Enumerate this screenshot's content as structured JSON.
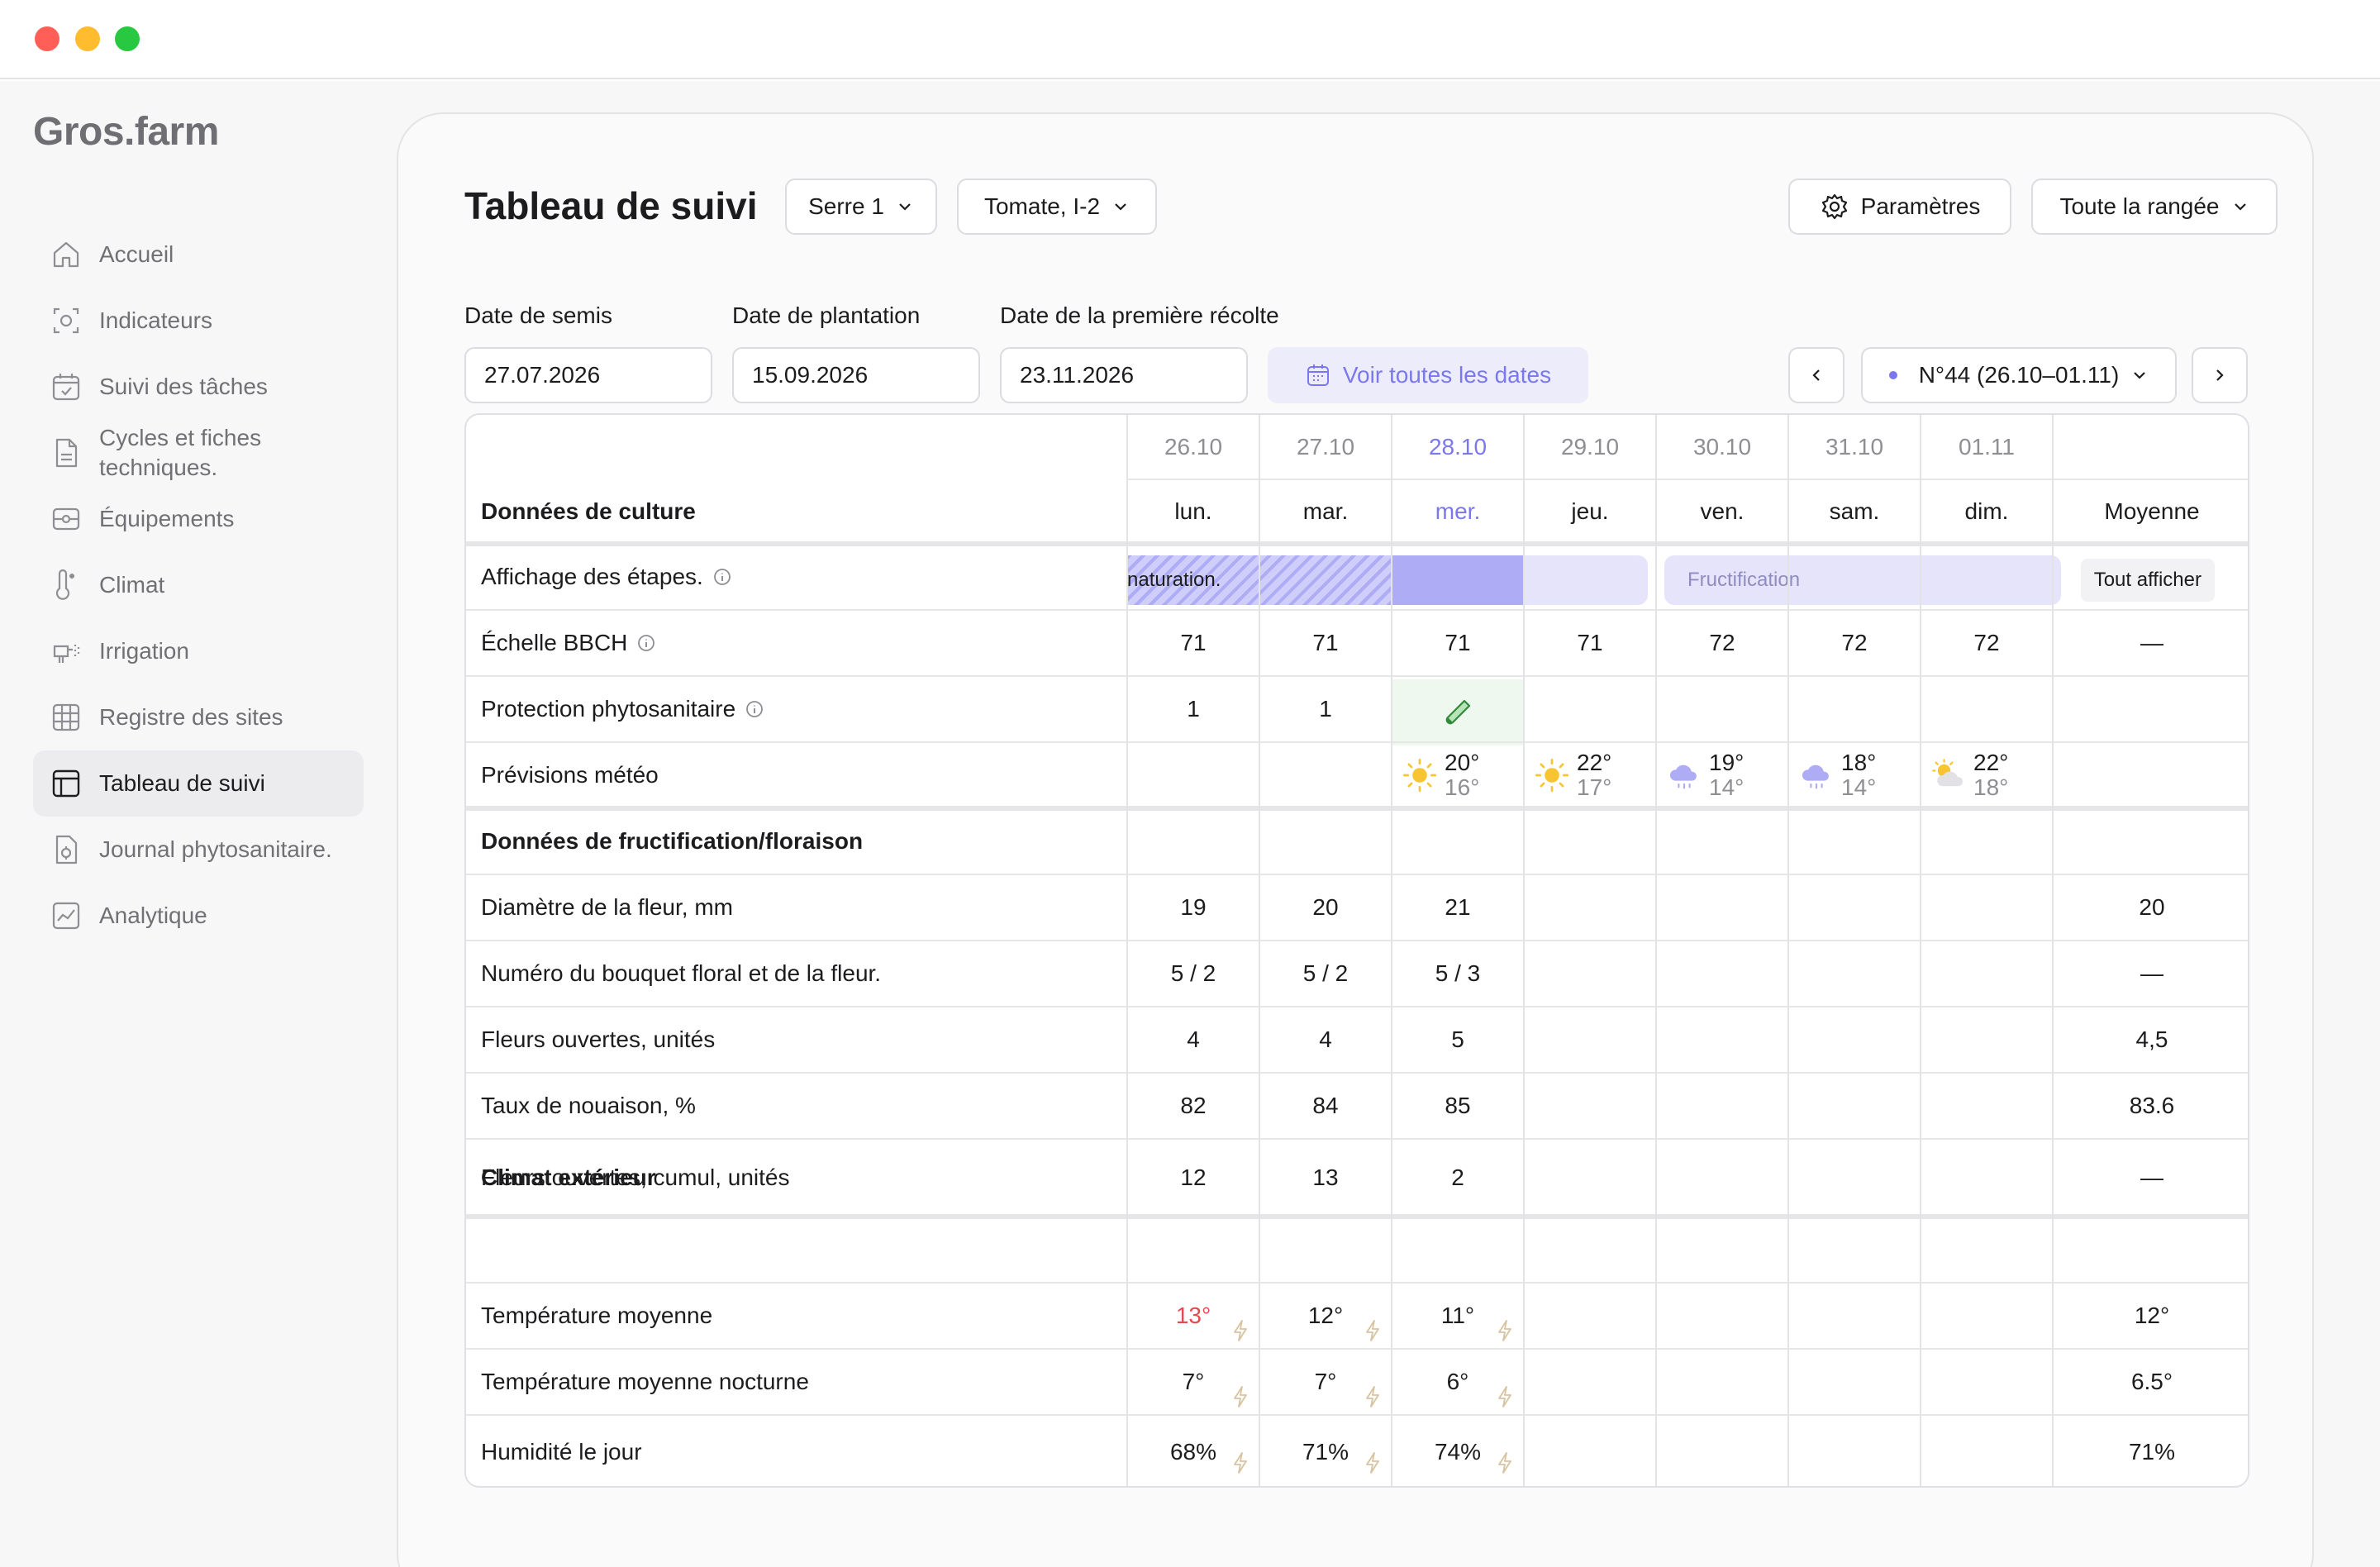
{
  "window": {
    "traffic_lights": [
      "#ff5f57",
      "#febc2e",
      "#28c840"
    ]
  },
  "sidebar": {
    "logo": "Gros.farm",
    "items": [
      {
        "label": "Accueil",
        "icon": "home-icon"
      },
      {
        "label": "Indicateurs",
        "icon": "indicators-icon"
      },
      {
        "label": "Suivi des tâches",
        "icon": "calendar-check-icon"
      },
      {
        "label": "Cycles et fiches techniques.",
        "icon": "document-icon"
      },
      {
        "label": "Équipements",
        "icon": "equipment-icon"
      },
      {
        "label": "Climat",
        "icon": "thermometer-icon"
      },
      {
        "label": "Irrigation",
        "icon": "irrigation-icon"
      },
      {
        "label": "Registre des sites",
        "icon": "grid-icon"
      },
      {
        "label": "Tableau de suivi",
        "icon": "table-icon",
        "active": true
      },
      {
        "label": "Journal phytosanitaire.",
        "icon": "journal-icon"
      },
      {
        "label": "Analytique",
        "icon": "analytics-icon"
      }
    ]
  },
  "header": {
    "title": "Tableau de suivi",
    "greenhouse_select": "Serre 1",
    "crop_select": "Tomate, I-2",
    "settings_label": "Paramètres",
    "row_select": "Toute la rangée"
  },
  "dates": {
    "sowing_label": "Date de semis",
    "sowing_value": "27.07.2026",
    "planting_label": "Date de plantation",
    "planting_value": "15.09.2026",
    "harvest_label": "Date de la première récolte",
    "harvest_value": "23.11.2026",
    "all_dates_label": "Voir toutes les dates",
    "week_label": "N°44 (26.10–01.11)"
  },
  "table": {
    "dates": [
      "26.10",
      "27.10",
      "28.10",
      "29.10",
      "30.10",
      "31.10",
      "01.11"
    ],
    "weekdays": [
      "lun.",
      "mar.",
      "mer.",
      "jeu.",
      "ven.",
      "sam.",
      "dim."
    ],
    "active_day_index": 2,
    "average_header": "Moyenne",
    "section_culture": "Données de culture",
    "stages_label": "Affichage des étapes.",
    "stage_maturation": "naturation.",
    "stage_fructification": "Fructification",
    "show_all": "Tout afficher",
    "bbch_label": "Échelle BBCH",
    "bbch_values": [
      "71",
      "71",
      "71",
      "71",
      "72",
      "72",
      "72"
    ],
    "bbch_avg": "—",
    "protection_label": "Protection phytosanitaire",
    "protection_values": [
      "1",
      "1",
      "",
      "",
      "",
      "",
      ""
    ],
    "weather_label": "Prévisions météo",
    "weather": [
      null,
      null,
      {
        "icon": "sun-icon",
        "hi": "20°",
        "lo": "16°"
      },
      {
        "icon": "sun-icon",
        "hi": "22°",
        "lo": "17°"
      },
      {
        "icon": "rain-cloud-icon",
        "hi": "19°",
        "lo": "14°"
      },
      {
        "icon": "rain-cloud-icon",
        "hi": "18°",
        "lo": "14°"
      },
      {
        "icon": "partly-cloudy-icon",
        "hi": "22°",
        "lo": "18°"
      }
    ],
    "section_fruit": "Données de fructification/floraison",
    "rows_fruit": [
      {
        "label": "Diamètre de la fleur, mm",
        "values": [
          "19",
          "20",
          "21"
        ],
        "avg": "20"
      },
      {
        "label": "Numéro du bouquet floral et de la fleur.",
        "values": [
          "5 / 2",
          "5 / 2",
          "5 / 3"
        ],
        "avg": "—"
      },
      {
        "label": "Fleurs ouvertes, unités",
        "values": [
          "4",
          "4",
          "5"
        ],
        "avg": "4,5"
      },
      {
        "label": "Taux de nouaison, %",
        "values": [
          "82",
          "84",
          "85"
        ],
        "avg": "83.6"
      },
      {
        "label": "Fleurs ouvertes, cumul, unités",
        "values": [
          "12",
          "13",
          "2"
        ],
        "avg": "—"
      }
    ],
    "section_climate": "Climat extérieur",
    "rows_climate": [
      {
        "label": "Température moyenne",
        "values": [
          "13°",
          "12°",
          "11°"
        ],
        "avg": "12°"
      },
      {
        "label": "Température moyenne nocturne",
        "values": [
          "7°",
          "7°",
          "6°"
        ],
        "avg": "6.5°"
      },
      {
        "label": "Humidité le jour",
        "values": [
          "68%",
          "71%",
          "74%"
        ],
        "avg": "71%"
      }
    ],
    "colors": {
      "accent": "#7b78ee",
      "alert": "#e5484d",
      "stage_light": "#e5e4fb",
      "stage_mid": "#aeacf5",
      "protection_cell": "#eef8ee"
    }
  }
}
